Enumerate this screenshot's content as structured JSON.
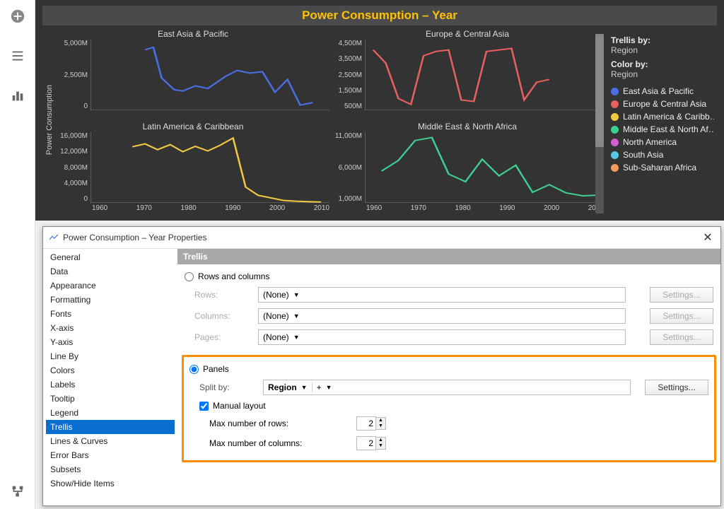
{
  "chart": {
    "title": "Power Consumption – Year",
    "y_axis_label": "Power Consumption",
    "trellis_by_label": "Trellis by:",
    "trellis_by_value": "Region",
    "color_by_label": "Color by:",
    "color_by_value": "Region",
    "x_ticks": [
      "1960",
      "1970",
      "1980",
      "1990",
      "2000",
      "2010"
    ]
  },
  "legend": [
    {
      "label": "East Asia & Pacific",
      "color": "#4a6fe3"
    },
    {
      "label": "Europe & Central Asia",
      "color": "#e85f5f"
    },
    {
      "label": "Latin America & Caribb…",
      "color": "#f2c744"
    },
    {
      "label": "Middle East & North Af…",
      "color": "#3dcf91"
    },
    {
      "label": "North America",
      "color": "#d15fd1"
    },
    {
      "label": "South Asia",
      "color": "#5ac6e8"
    },
    {
      "label": "Sub-Saharan Africa",
      "color": "#f29b5f"
    }
  ],
  "chart_data": [
    {
      "type": "line",
      "title": "East Asia & Pacific",
      "color": "#4a6fe3",
      "yticks": [
        "5,000M",
        "2,500M",
        "0"
      ],
      "ylim": [
        0,
        5500
      ],
      "x": [
        1971,
        1973,
        1975,
        1978,
        1980,
        1983,
        1986,
        1990,
        1993,
        1996,
        1999,
        2002,
        2005,
        2008,
        2011
      ],
      "values": [
        4700,
        4900,
        2500,
        1600,
        1500,
        1900,
        1700,
        2600,
        3100,
        2900,
        3000,
        1400,
        2400,
        400,
        600
      ]
    },
    {
      "type": "line",
      "title": "Europe & Central Asia",
      "color": "#e85f5f",
      "yticks": [
        "4,500M",
        "3,500M",
        "2,500M",
        "1,500M",
        "500M"
      ],
      "ylim": [
        0,
        4800
      ],
      "x": [
        1960,
        1963,
        1966,
        1969,
        1972,
        1975,
        1978,
        1981,
        1984,
        1987,
        1990,
        1993,
        1996,
        1999,
        2002
      ],
      "values": [
        4100,
        3200,
        800,
        400,
        3700,
        4000,
        4100,
        700,
        600,
        4000,
        4100,
        4200,
        700,
        1900,
        2100
      ]
    },
    {
      "type": "line",
      "title": "Latin America & Caribbean",
      "color": "#f2c744",
      "yticks": [
        "16,000M",
        "12,000M",
        "8,000M",
        "4,000M",
        "0"
      ],
      "ylim": [
        0,
        17000
      ],
      "x": [
        1968,
        1971,
        1974,
        1977,
        1980,
        1983,
        1986,
        1989,
        1992,
        1995,
        1998,
        2001,
        2004,
        2007,
        2010,
        2013
      ],
      "values": [
        13500,
        14200,
        12800,
        14000,
        12300,
        13600,
        12500,
        13900,
        15600,
        3800,
        1800,
        1200,
        600,
        400,
        300,
        200
      ]
    },
    {
      "type": "line",
      "title": "Middle East & North Africa",
      "color": "#3dcf91",
      "yticks": [
        "11,000M",
        "6,000M",
        "1,000M"
      ],
      "ylim": [
        0,
        12000
      ],
      "x": [
        1962,
        1966,
        1970,
        1974,
        1978,
        1982,
        1986,
        1990,
        1994,
        1998,
        2002,
        2006,
        2010,
        2013
      ],
      "values": [
        5400,
        7200,
        10600,
        11100,
        4900,
        3600,
        7400,
        4600,
        6400,
        1800,
        3100,
        1700,
        1200,
        1300
      ]
    }
  ],
  "dialog": {
    "title": "Power Consumption – Year Properties",
    "nav": [
      "General",
      "Data",
      "Appearance",
      "Formatting",
      "Fonts",
      "X-axis",
      "Y-axis",
      "Line By",
      "Colors",
      "Labels",
      "Tooltip",
      "Legend",
      "Trellis",
      "Lines & Curves",
      "Error Bars",
      "Subsets",
      "Show/Hide Items"
    ],
    "nav_selected": "Trellis",
    "section_title": "Trellis",
    "rows_and_columns_label": "Rows and columns",
    "rows_label": "Rows:",
    "columns_label": "Columns:",
    "pages_label": "Pages:",
    "none_label": "(None)",
    "settings_label": "Settings...",
    "panels_label": "Panels",
    "split_by_label": "Split by:",
    "split_by_value": "Region",
    "manual_layout_label": "Manual layout",
    "max_rows_label": "Max number of rows:",
    "max_rows_value": "2",
    "max_cols_label": "Max number of columns:",
    "max_cols_value": "2"
  }
}
